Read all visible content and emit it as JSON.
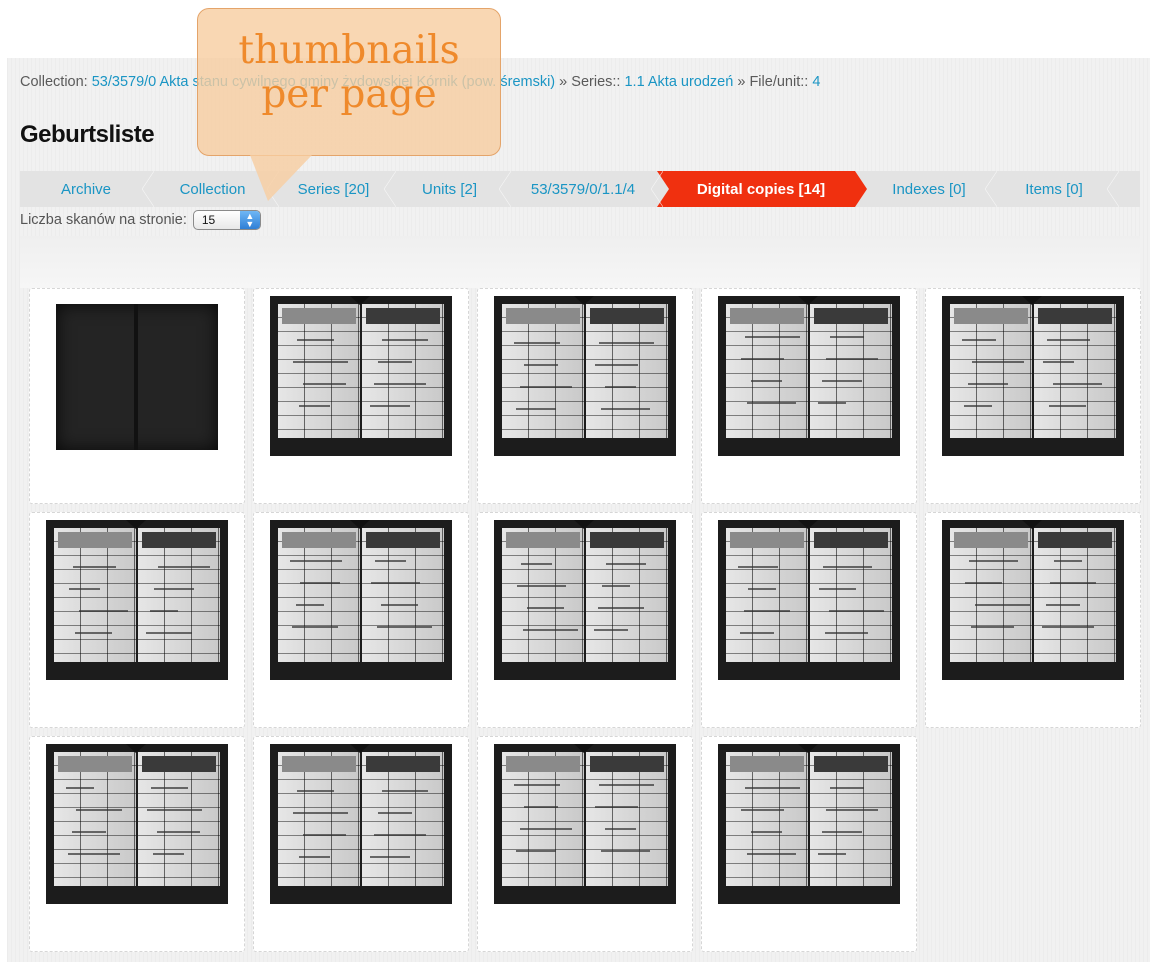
{
  "breadcrumb": {
    "collection_label": "Collection:",
    "collection_link": "53/3579/0 Akta stanu cywilnego gminy żydowskiej Kórnik (pow. śremski)",
    "sep1": "»",
    "series_label": "Series::",
    "series_link": "1.1 Akta urodzeń",
    "sep2": "»",
    "file_label": "File/unit::",
    "file_link": "4"
  },
  "page_title": "Geburtsliste",
  "tabs": [
    {
      "label": "Archive",
      "active": false
    },
    {
      "label": "Collection",
      "active": false
    },
    {
      "label": "Series [20]",
      "active": false
    },
    {
      "label": "Units [2]",
      "active": false
    },
    {
      "label": "53/3579/0/1.1/4",
      "active": false
    },
    {
      "label": "Digital copies [14]",
      "active": true
    },
    {
      "label": "Indexes [0]",
      "active": false
    },
    {
      "label": "Items [0]",
      "active": false
    }
  ],
  "per_page": {
    "label": "Liczba skanów na stronie:",
    "value": "15"
  },
  "thumbnails_count": 14,
  "callout": {
    "line1": "thumbnails",
    "line2": "per page"
  },
  "colors": {
    "link": "#1a95c4",
    "active_tab": "#f0300f",
    "callout_fill": "#f8cda0",
    "callout_text": "#ef8a2c"
  }
}
